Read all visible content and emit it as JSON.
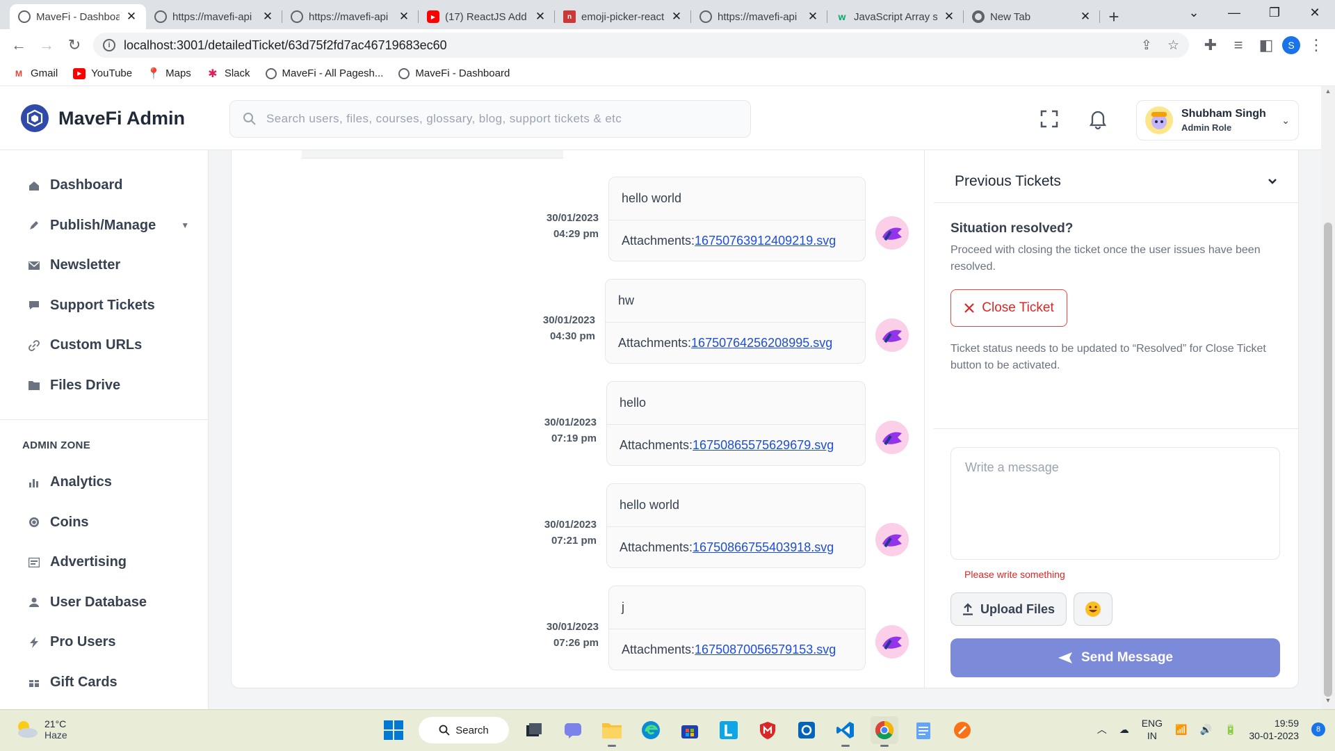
{
  "browser": {
    "tabs": [
      {
        "title": "MaveFi - Dashboard",
        "icon": "globe-icon",
        "active": true
      },
      {
        "title": "https://mavefi-api",
        "icon": "globe-icon",
        "active": false
      },
      {
        "title": "https://mavefi-api",
        "icon": "globe-icon",
        "active": false
      },
      {
        "title": "(17) ReactJS Add",
        "icon": "youtube-icon",
        "active": false
      },
      {
        "title": "emoji-picker-react",
        "icon": "npm-icon",
        "active": false
      },
      {
        "title": "https://mavefi-api",
        "icon": "globe-icon",
        "active": false
      },
      {
        "title": "JavaScript Array s",
        "icon": "w3-icon",
        "active": false
      },
      {
        "title": "New Tab",
        "icon": "chrome-icon",
        "active": false
      }
    ],
    "url": "localhost:3001/detailedTicket/63d75f2fd7ac46719683ec60",
    "profile_initial": "S",
    "bookmarks": [
      {
        "label": "Gmail",
        "icon": "gmail-icon"
      },
      {
        "label": "YouTube",
        "icon": "youtube-icon"
      },
      {
        "label": "Maps",
        "icon": "maps-icon"
      },
      {
        "label": "Slack",
        "icon": "slack-icon"
      },
      {
        "label": "MaveFi - All Pagesh...",
        "icon": "globe-icon"
      },
      {
        "label": "MaveFi - Dashboard",
        "icon": "globe-icon"
      }
    ]
  },
  "header": {
    "brand": "MaveFi Admin",
    "search_placeholder": "Search users, files, courses, glossary, blog, support tickets & etc",
    "user_name": "Shubham Singh",
    "user_role": "Admin Role"
  },
  "sidebar": {
    "items": [
      {
        "label": "Dashboard",
        "icon": "home-icon"
      },
      {
        "label": "Publish/Manage",
        "icon": "pen-icon"
      },
      {
        "label": "Newsletter",
        "icon": "mail-icon"
      },
      {
        "label": "Support Tickets",
        "icon": "chat-icon"
      },
      {
        "label": "Custom URLs",
        "icon": "link-icon"
      },
      {
        "label": "Files Drive",
        "icon": "folder-icon"
      }
    ],
    "zone_label": "ADMIN ZONE",
    "admin_items": [
      {
        "label": "Analytics",
        "icon": "bar-chart-icon"
      },
      {
        "label": "Coins",
        "icon": "coin-icon"
      },
      {
        "label": "Advertising",
        "icon": "ad-icon"
      },
      {
        "label": "User Database",
        "icon": "user-icon"
      },
      {
        "label": "Pro Users",
        "icon": "bolt-icon"
      },
      {
        "label": "Gift Cards",
        "icon": "gift-icon"
      }
    ]
  },
  "messages": [
    {
      "text": "hello world",
      "attach_label": "Attachments:",
      "file": "16750763912409219.svg",
      "date": "30/01/2023",
      "time": "04:29 pm"
    },
    {
      "text": "hw",
      "attach_label": "Attachments:",
      "file": "16750764256208995.svg",
      "date": "30/01/2023",
      "time": "04:30 pm"
    },
    {
      "text": "hello",
      "attach_label": "Attachments:",
      "file": "16750865575629679.svg",
      "date": "30/01/2023",
      "time": "07:19 pm"
    },
    {
      "text": "hello world",
      "attach_label": "Attachments:",
      "file": "16750866755403918.svg",
      "date": "30/01/2023",
      "time": "07:21 pm"
    },
    {
      "text": "j",
      "attach_label": "Attachments:",
      "file": "16750870056579153.svg",
      "date": "30/01/2023",
      "time": "07:26 pm"
    }
  ],
  "panel": {
    "previous_tickets": "Previous Tickets",
    "resolved_title": "Situation resolved?",
    "resolved_desc": "Proceed with closing the ticket once the user issues have been resolved.",
    "close_label": "Close Ticket",
    "status_note": "Ticket status needs to be updated to “Resolved” for Close Ticket button to be activated.",
    "message_placeholder": "Write a message",
    "error": "Please write something",
    "upload_label": "Upload Files",
    "send_label": "Send Message"
  },
  "taskbar": {
    "temp": "21°C",
    "condition": "Haze",
    "search_label": "Search",
    "lang_1": "ENG",
    "lang_2": "IN",
    "time": "19:59",
    "date": "30-01-2023",
    "notifications": "8"
  },
  "colors": {
    "accent": "#7b8ad9",
    "brand": "#2f4aa8",
    "danger": "#dc2626",
    "link": "#1d4ed8"
  }
}
